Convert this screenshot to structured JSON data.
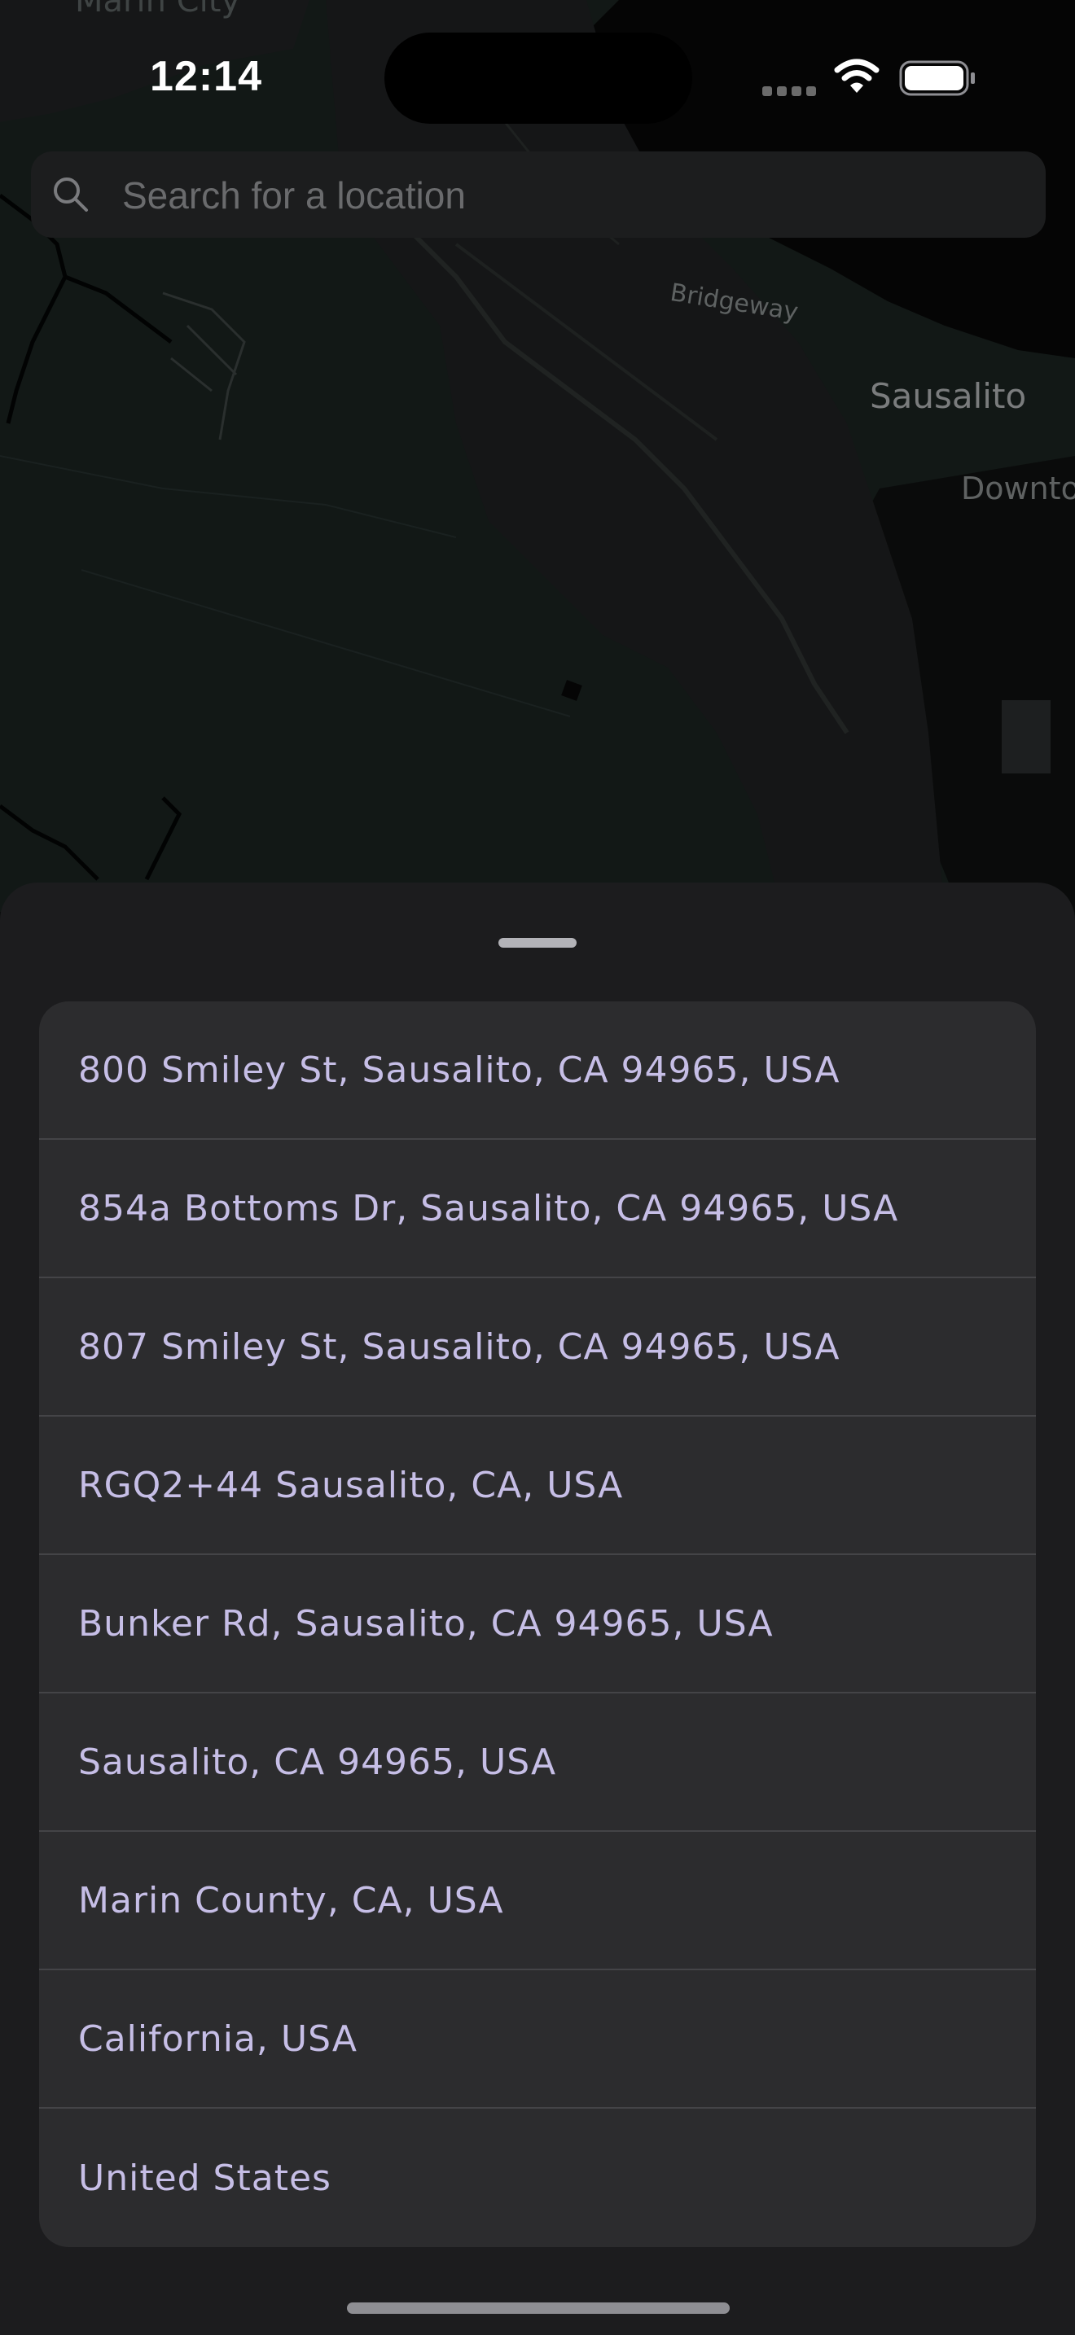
{
  "map": {
    "labels": {
      "marin_city": "Marin City",
      "bridgeway": "Bridgeway",
      "sausalito": "Sausalito",
      "downtown": "Downto"
    }
  },
  "status_bar": {
    "time": "12:14",
    "icons": [
      "signal-icon",
      "wifi-icon",
      "battery-icon"
    ]
  },
  "search": {
    "placeholder": "Search for a location",
    "value": "",
    "icon": "search-icon"
  },
  "results": [
    {
      "label": "800 Smiley St, Sausalito, CA 94965, USA"
    },
    {
      "label": "854a Bottoms Dr, Sausalito, CA 94965, USA"
    },
    {
      "label": "807 Smiley St, Sausalito, CA 94965, USA"
    },
    {
      "label": "RGQ2+44 Sausalito, CA, USA"
    },
    {
      "label": "Bunker Rd, Sausalito, CA 94965, USA"
    },
    {
      "label": "Sausalito, CA 94965, USA"
    },
    {
      "label": "Marin County, CA, USA"
    },
    {
      "label": "California, USA"
    },
    {
      "label": "United States"
    }
  ],
  "colors": {
    "map_land": "#121816",
    "map_water": "#050505",
    "sheet_background": "#1c1c1e",
    "results_background": "#2c2c2e",
    "result_text": "#c6bee6",
    "separator": "#444447"
  }
}
